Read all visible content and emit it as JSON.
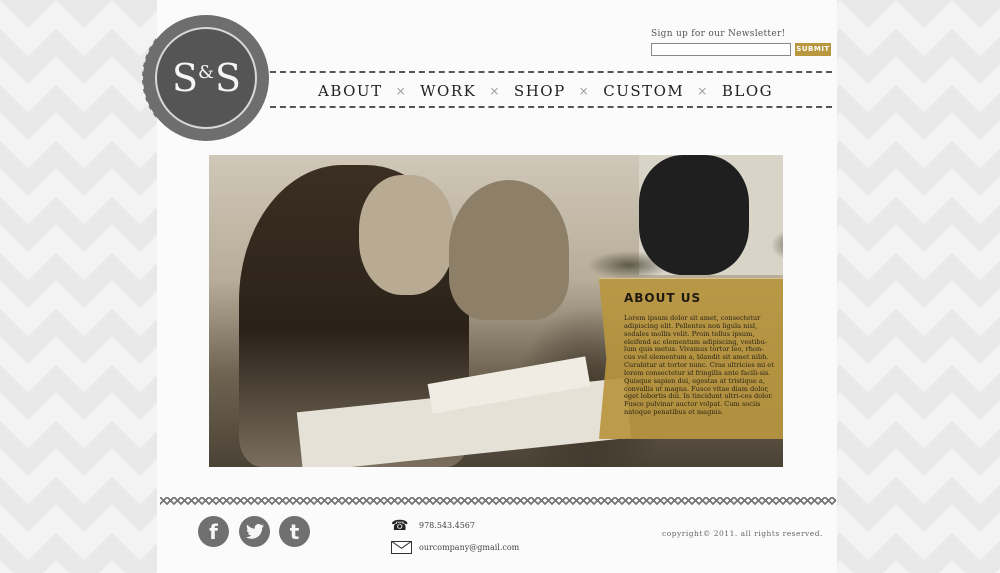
{
  "logo": {
    "left": "S",
    "amp": "&",
    "right": "S"
  },
  "newsletter": {
    "label": "Sign up for our Newsletter!",
    "placeholder": "",
    "submit_label": "SUBMIT"
  },
  "nav": {
    "items": [
      "ABOUT",
      "WORK",
      "SHOP",
      "CUSTOM",
      "BLOG"
    ],
    "separator": "×"
  },
  "about": {
    "title": "ABOUT US",
    "body": "Lorem ipsum dolor sit amet, consectetur adipiscing elit. Pellentes non ligula nisl, sodales mollis velit. Proin tellus ipsum, eleifend ac elementum adipiscing, vestibu-lum quis metus. Vivamus tortor leo, rhon-cus vel elementum a, blandit sit amet nibh. Curabitur at tortor nunc. Cras ultricies mi et lorem consectetur id fringilla ante facili-sis. Quisque sapien dui, egestas at tristique a, convallis ut magna. Fusce vitae diam dolor, eget lobortis dui. In tincidunt ultri-ces dolor. Fusce pulvinar auctor volpat. Cum sociis natoque penatibus et magnis."
  },
  "social": {
    "facebook": "f",
    "twitter": "t",
    "tumblr": "t"
  },
  "contact": {
    "phone": "978.543.4567",
    "email": "ourcompany@gmail.com"
  },
  "copyright": "copyright© 2011. all rights reserved.",
  "icons": [
    "phone-icon",
    "mail-icon",
    "facebook-icon",
    "twitter-icon",
    "tumblr-icon"
  ],
  "colors": {
    "accent": "#b8973f",
    "dark": "#555555"
  }
}
